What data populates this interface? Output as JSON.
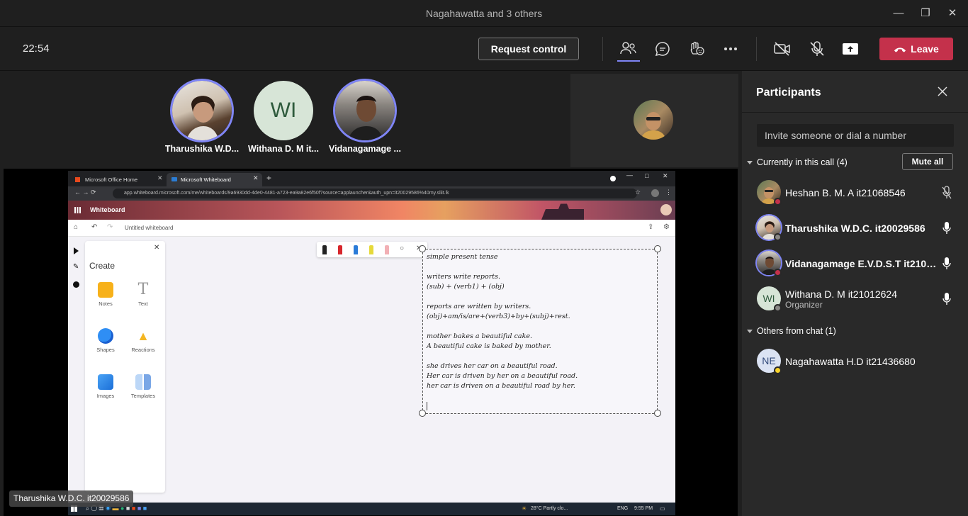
{
  "window": {
    "title": "Nagahawatta and 3 others",
    "minimize": "—",
    "restore": "❐",
    "close": "✕"
  },
  "toolbar": {
    "time": "22:54",
    "request_control": "Request control",
    "leave": "Leave"
  },
  "gallery": [
    {
      "name": "Tharushika W.D..."
    },
    {
      "name": "Withana D. M it...",
      "initials": "WI"
    },
    {
      "name": "Vidanagamage ..."
    }
  ],
  "shared_screen": {
    "tabs": [
      "Microsoft Office Home",
      "Microsoft Whiteboard"
    ],
    "url": "app.whiteboard.microsoft.com/me/whiteboards/9a6930dd-4de0-4481-a723-ea9a82e6f50f?source=applauncher&auth_upn=it20029586%40my.sliit.lk",
    "app_name": "Whiteboard",
    "board_name": "Untitled whiteboard",
    "create_title": "Create",
    "create_items": [
      "Notes",
      "Text",
      "Shapes",
      "Reactions",
      "Images",
      "Templates"
    ],
    "note_lines": [
      "simple present tense",
      "",
      "writers write reports.",
      "(sub)  + (verb1) + (obj)",
      "",
      "reports are written by writers.",
      "(obj)+am/is/are+(verb3)+by+(subj)+rest.",
      "",
      "mother bakes a beautiful cake.",
      "A beautiful cake is baked by mother.",
      "",
      "she drives her car on a beautiful road.",
      "Her car is driven by her on a beautiful road.",
      "her car is driven on a beautiful road by her."
    ],
    "taskbar_weather": "28°C  Partly clo...",
    "taskbar_lang": "ENG",
    "taskbar_time": "9:55 PM",
    "presenter": "Tharushika W.D.C. it20029586"
  },
  "participants": {
    "title": "Participants",
    "invite_placeholder": "Invite someone or dial a number",
    "in_call_header": "Currently in this call (4)",
    "mute_all": "Mute all",
    "in_call": [
      {
        "name": "Heshan B. M. A it21068546",
        "mic": "muted"
      },
      {
        "name": "Tharushika W.D.C. it20029586",
        "mic": "on"
      },
      {
        "name": "Vidanagamage E.V.D.S.T it2100...",
        "mic": "on"
      },
      {
        "name": "Withana D. M it21012624",
        "role": "Organizer",
        "initials": "WI",
        "mic": "on"
      }
    ],
    "chat_header": "Others from chat (1)",
    "from_chat": [
      {
        "name": "Nagahawatta H.D it21436680",
        "initials": "NE"
      }
    ]
  },
  "colors": {
    "accent": "#7f85f5",
    "leave": "#c4314b",
    "panel": "#292929"
  }
}
